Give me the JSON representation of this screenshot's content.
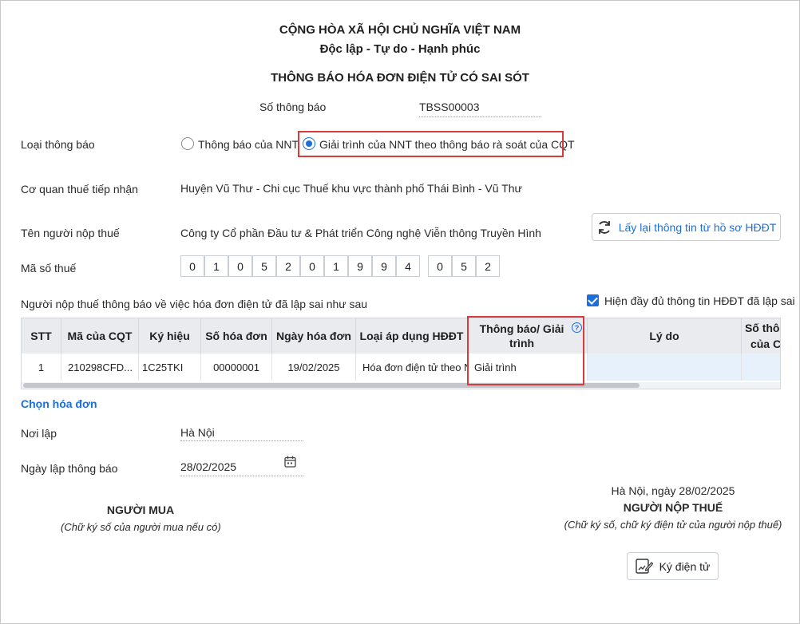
{
  "header": {
    "country": "CỘNG HÒA XÃ HỘI CHỦ NGHĨA VIỆT NAM",
    "motto": "Độc lập - Tự do - Hạnh phúc",
    "title": "THÔNG BÁO HÓA ĐƠN ĐIỆN TỬ CÓ SAI SÓT"
  },
  "notice_number": {
    "label": "Số thông báo",
    "value": "TBSS00003"
  },
  "notice_type": {
    "label": "Loại thông báo",
    "option1": "Thông báo của NNT",
    "option2": "Giải trình của NNT theo thông báo rà soát của CQT",
    "selected": "option2"
  },
  "tax_office": {
    "label": "Cơ quan thuế tiếp nhận",
    "value": "Huyện Vũ Thư - Chi cục Thuế khu vực thành phố Thái Bình - Vũ Thư"
  },
  "taxpayer_name": {
    "label": "Tên người nộp thuế",
    "value": "Công ty Cổ phần Đầu tư & Phát triển Công nghệ Viễn thông Truyền Hình"
  },
  "reload_button": {
    "label": "Lấy lại thông tin từ hồ sơ HĐĐT"
  },
  "tax_code": {
    "label": "Mã số thuế",
    "digits": [
      "0",
      "1",
      "0",
      "5",
      "2",
      "0",
      "1",
      "9",
      "9",
      "4"
    ],
    "branch": [
      "0",
      "5",
      "2"
    ]
  },
  "invoice_section": {
    "label": "Người nộp thuế thông báo về việc hóa đơn điện tử đã lập sai như sau",
    "show_full_label": "Hiện đầy đủ thông tin HĐĐT đã lập sai",
    "show_full_checked": true
  },
  "table": {
    "columns": {
      "stt": "STT",
      "cqt_code": "Mã của CQT",
      "symbol": "Ký hiệu",
      "invoice_no": "Số hóa đơn",
      "invoice_date": "Ngày hóa đơn",
      "apply_type": "Loại áp dụng HĐĐT",
      "notice_expl": "Thông báo/ Giải trình",
      "reason": "Lý do",
      "extra": "Số thôn của C"
    },
    "rows": [
      {
        "stt": "1",
        "cqt_code": "210298CFD...",
        "symbol": "1C25TKI",
        "invoice_no": "00000001",
        "invoice_date": "19/02/2025",
        "apply_type": "Hóa đơn điện tử theo Ng",
        "notice_expl": "Giải trình",
        "reason": ""
      }
    ]
  },
  "choose_invoice": "Chọn hóa đơn",
  "place": {
    "label": "Nơi lập",
    "value": "Hà Nội"
  },
  "notice_date": {
    "label": "Ngày lập thông báo",
    "value": "28/02/2025"
  },
  "buyer": {
    "title": "NGƯỜI MUA",
    "note": "(Chữ ký số của người mua nếu có)"
  },
  "taxpayer_sign": {
    "date_line": "Hà Nội, ngày 28/02/2025",
    "title": "NGƯỜI NỘP THUẾ",
    "note": "(Chữ ký số, chữ ký điện tử của người nộp thuế)"
  },
  "sign_button": {
    "label": "Ký điện tử"
  },
  "colors": {
    "accent": "#1a6fdb",
    "highlight": "#d93b3b",
    "header_bg": "#e9ebee"
  },
  "icons": {
    "reload": "refresh-icon",
    "calendar": "calendar-icon",
    "help": "help-circle-icon",
    "sign": "signature-icon"
  }
}
